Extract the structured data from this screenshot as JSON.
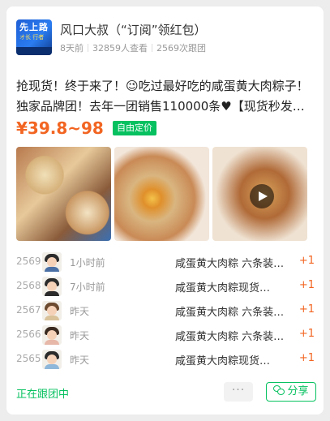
{
  "author": {
    "avatar_text": "先上路",
    "avatar_sub": "オ长 行者",
    "name": "风口大叔（“订阅”领红包）",
    "posted": "8天前",
    "views": "32859人查看",
    "joined": "2569次跟团"
  },
  "post": {
    "title": "抢现货！终于来了！😉吃过最好吃的咸蛋黄大肉粽子！独家品牌团！去年一团销售110000条♥【现货秒发…",
    "price": "¥39.8~98",
    "badge": "自由定价"
  },
  "orders": [
    {
      "num": "2569",
      "time": "1小时前",
      "product": "咸蛋黄大肉粽 六条装…",
      "qty": "+1"
    },
    {
      "num": "2568",
      "time": "7小时前",
      "product": "咸蛋黄大肉粽现货…",
      "qty": "+1"
    },
    {
      "num": "2567",
      "time": "昨天",
      "product": "咸蛋黄大肉粽 六条装…",
      "qty": "+1"
    },
    {
      "num": "2566",
      "time": "昨天",
      "product": "咸蛋黄大肉粽 六条装…",
      "qty": "+1"
    },
    {
      "num": "2565",
      "time": "昨天",
      "product": "咸蛋黄大肉粽现货…",
      "qty": "+1"
    }
  ],
  "footer": {
    "status": "正在跟团中",
    "more": "···",
    "share": "分享"
  },
  "colors": {
    "accent": "#07c160",
    "price": "#f26522"
  },
  "icons": {
    "play": "play-icon",
    "share": "wechat-icon"
  }
}
